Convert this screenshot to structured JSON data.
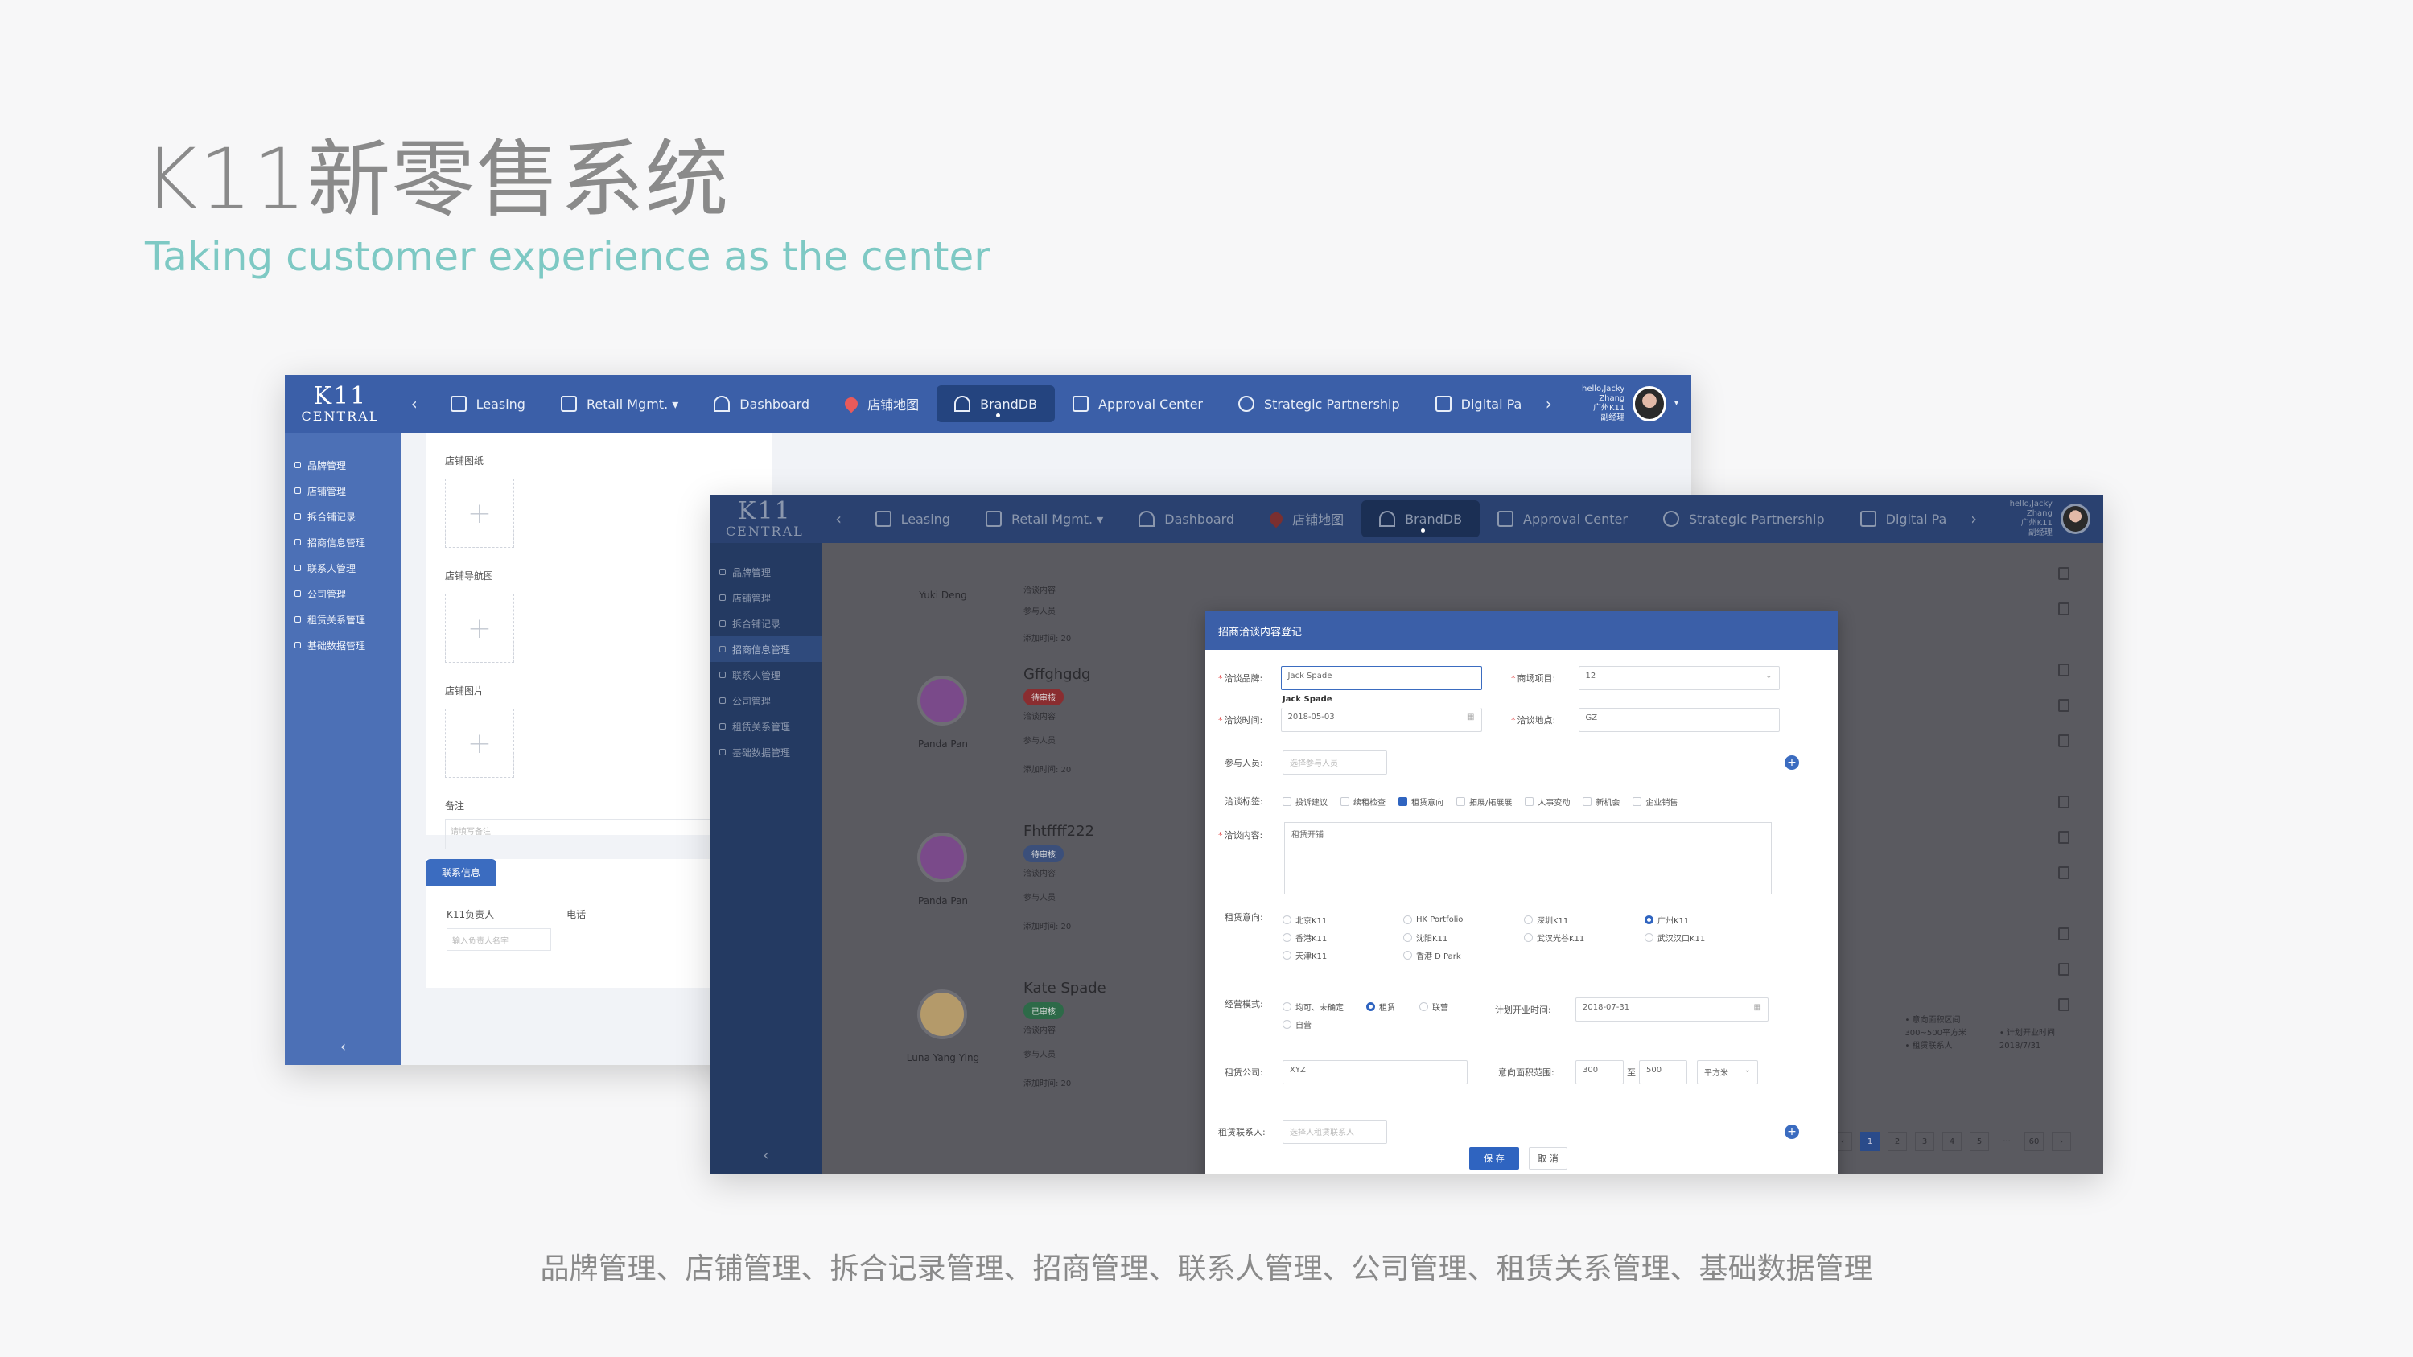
{
  "slide": {
    "title": "K11新零售系统",
    "subtitle": "Taking customer experience as the center",
    "caption": "品牌管理、店铺管理、拆合记录管理、招商管理、联系人管理、公司管理、租赁关系管理、基础数据管理"
  },
  "app": {
    "logo_top": "K11",
    "logo_bottom": "CENTRAL",
    "nav": [
      {
        "label": "Leasing"
      },
      {
        "label": "Retail Mgmt. ▾"
      },
      {
        "label": "Dashboard"
      },
      {
        "label": "店铺地图"
      },
      {
        "label": "BrandDB"
      },
      {
        "label": "Approval Center"
      },
      {
        "label": "Strategic Partnership"
      },
      {
        "label": "Digital Pa"
      }
    ],
    "user": {
      "line1": "hello,Jacky Zhang",
      "line2": "广州K11",
      "line3": "副经理"
    },
    "sidebar": [
      {
        "label": "品牌管理"
      },
      {
        "label": "店铺管理"
      },
      {
        "label": "拆合铺记录"
      },
      {
        "label": "招商信息管理"
      },
      {
        "label": "联系人管理"
      },
      {
        "label": "公司管理"
      },
      {
        "label": "租赁关系管理"
      },
      {
        "label": "基础数据管理"
      }
    ],
    "collapse": "‹"
  },
  "back_form": {
    "label_drawing": "店铺图纸",
    "label_nav_map": "店铺导航图",
    "label_photo": "店铺图片",
    "label_remark": "备注",
    "remark_placeholder": "请填写备注",
    "contact_tab": "联系信息",
    "k11_owner": "K11负责人",
    "phone": "电话",
    "owner_placeholder": "输入负责人名字"
  },
  "front_list": {
    "brands": [
      {
        "person": "Yuki Deng",
        "name": "",
        "badge": "",
        "meta1": "洽谈内容",
        "meta2": "参与人员",
        "meta3": "添加时间: 20"
      },
      {
        "person": "Panda Pan",
        "name": "Gffghgdg",
        "badge": "待审核",
        "meta1": "洽谈内容",
        "meta2": "参与人员",
        "meta3": "添加时间: 20"
      },
      {
        "person": "Panda Pan",
        "name": "Fhtffff222",
        "badge": "待审核",
        "meta1": "洽谈内容",
        "meta2": "参与人员",
        "meta3": "添加时间: 20"
      },
      {
        "person": "Luna Yang Ying",
        "name": "Kate Spade",
        "badge": "已审核",
        "meta1": "洽谈内容",
        "meta2": "参与人员",
        "meta3": "添加时间: 20"
      }
    ],
    "side_note1": "• 意向面积区间",
    "side_note2": "300~500平方米",
    "side_note3": "• 计划开业时间",
    "side_note4": "2018/7/31",
    "side_note5": "• 租赁联系人",
    "pages": [
      "‹",
      "1",
      "2",
      "3",
      "4",
      "5",
      "···",
      "60",
      "›"
    ]
  },
  "modal": {
    "title": "招商洽谈内容登记",
    "brand_label": "洽谈品牌:",
    "brand_value": "Jack Spade",
    "suggest": "Jack Spade",
    "project_label": "商场项目:",
    "project_value": "12",
    "time_label": "洽谈时间:",
    "time_value": "2018-05-03",
    "place_label": "洽谈地点:",
    "place_value": "GZ",
    "people_label": "参与人员:",
    "people_placeholder": "选择参与人员",
    "tags_label": "洽谈标签:",
    "tags": [
      {
        "label": "投诉建议",
        "on": false
      },
      {
        "label": "续租检查",
        "on": false
      },
      {
        "label": "租赁意向",
        "on": true
      },
      {
        "label": "拓展/拓展展",
        "on": false
      },
      {
        "label": "人事变动",
        "on": false
      },
      {
        "label": "新机会",
        "on": false
      },
      {
        "label": "企业销售",
        "on": false
      }
    ],
    "content_label": "洽谈内容:",
    "content_value": "租赁开铺",
    "intent_label": "租赁意向:",
    "intent_options": [
      {
        "label": "北京K11",
        "on": false
      },
      {
        "label": "HK Portfolio",
        "on": false
      },
      {
        "label": "深圳K11",
        "on": false
      },
      {
        "label": "广州K11",
        "on": true
      },
      {
        "label": "香港K11",
        "on": false
      },
      {
        "label": "沈阳K11",
        "on": false
      },
      {
        "label": "武汉光谷K11",
        "on": false
      },
      {
        "label": "武汉汉口K11",
        "on": false
      },
      {
        "label": "天津K11",
        "on": false
      },
      {
        "label": "香港 D Park",
        "on": false
      }
    ],
    "mode_label": "经营模式:",
    "mode_options": [
      {
        "label": "均可、未确定",
        "on": false
      },
      {
        "label": "租赁",
        "on": true
      },
      {
        "label": "联营",
        "on": false
      },
      {
        "label": "自营",
        "on": false
      }
    ],
    "open_label": "计划开业时间:",
    "open_value": "2018-07-31",
    "company_label": "租赁公司:",
    "company_value": "XYZ",
    "area_label": "意向面积范围:",
    "area_from": "300",
    "area_sep": "至",
    "area_to": "500",
    "area_unit": "平方米",
    "contact_label": "租赁联系人:",
    "contact_placeholder": "选择人租赁联系人",
    "save": "保 存",
    "cancel": "取 消"
  }
}
